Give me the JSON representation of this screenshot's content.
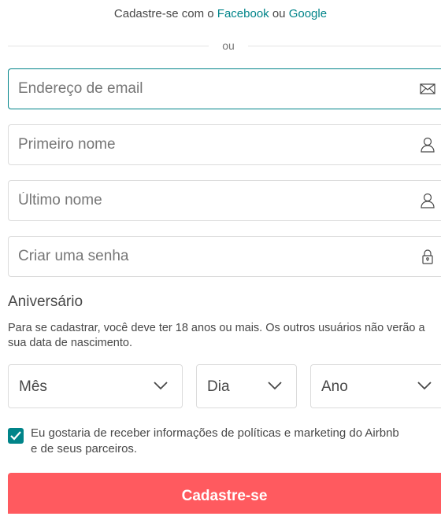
{
  "signup_social": {
    "prefix": "Cadastre-se com o ",
    "facebook_label": "Facebook",
    "middle": " ou ",
    "google_label": "Google"
  },
  "divider_text": "ou",
  "fields": {
    "email_placeholder": "Endereço de email",
    "first_name_placeholder": "Primeiro nome",
    "last_name_placeholder": "Último nome",
    "password_placeholder": "Criar uma senha"
  },
  "birthday": {
    "title": "Aniversário",
    "description": "Para se cadastrar, você deve ter 18 anos ou mais. Os outros usuários não verão a sua data de nascimento.",
    "month_label": "Mês",
    "day_label": "Dia",
    "year_label": "Ano"
  },
  "marketing": {
    "checked": true,
    "label_line1": "Eu gostaria de receber informações de políticas e marketing do Airbnb",
    "label_line2": "e de seus parceiros."
  },
  "submit_label": "Cadastre-se",
  "colors": {
    "accent": "#008489",
    "button": "#ff5a5f",
    "text": "#484848"
  },
  "icons": {
    "email": "envelope-icon",
    "first_name": "person-icon",
    "last_name": "person-icon",
    "password": "lock-icon",
    "select": "chevron-down-icon",
    "checkbox": "checkmark-icon"
  }
}
